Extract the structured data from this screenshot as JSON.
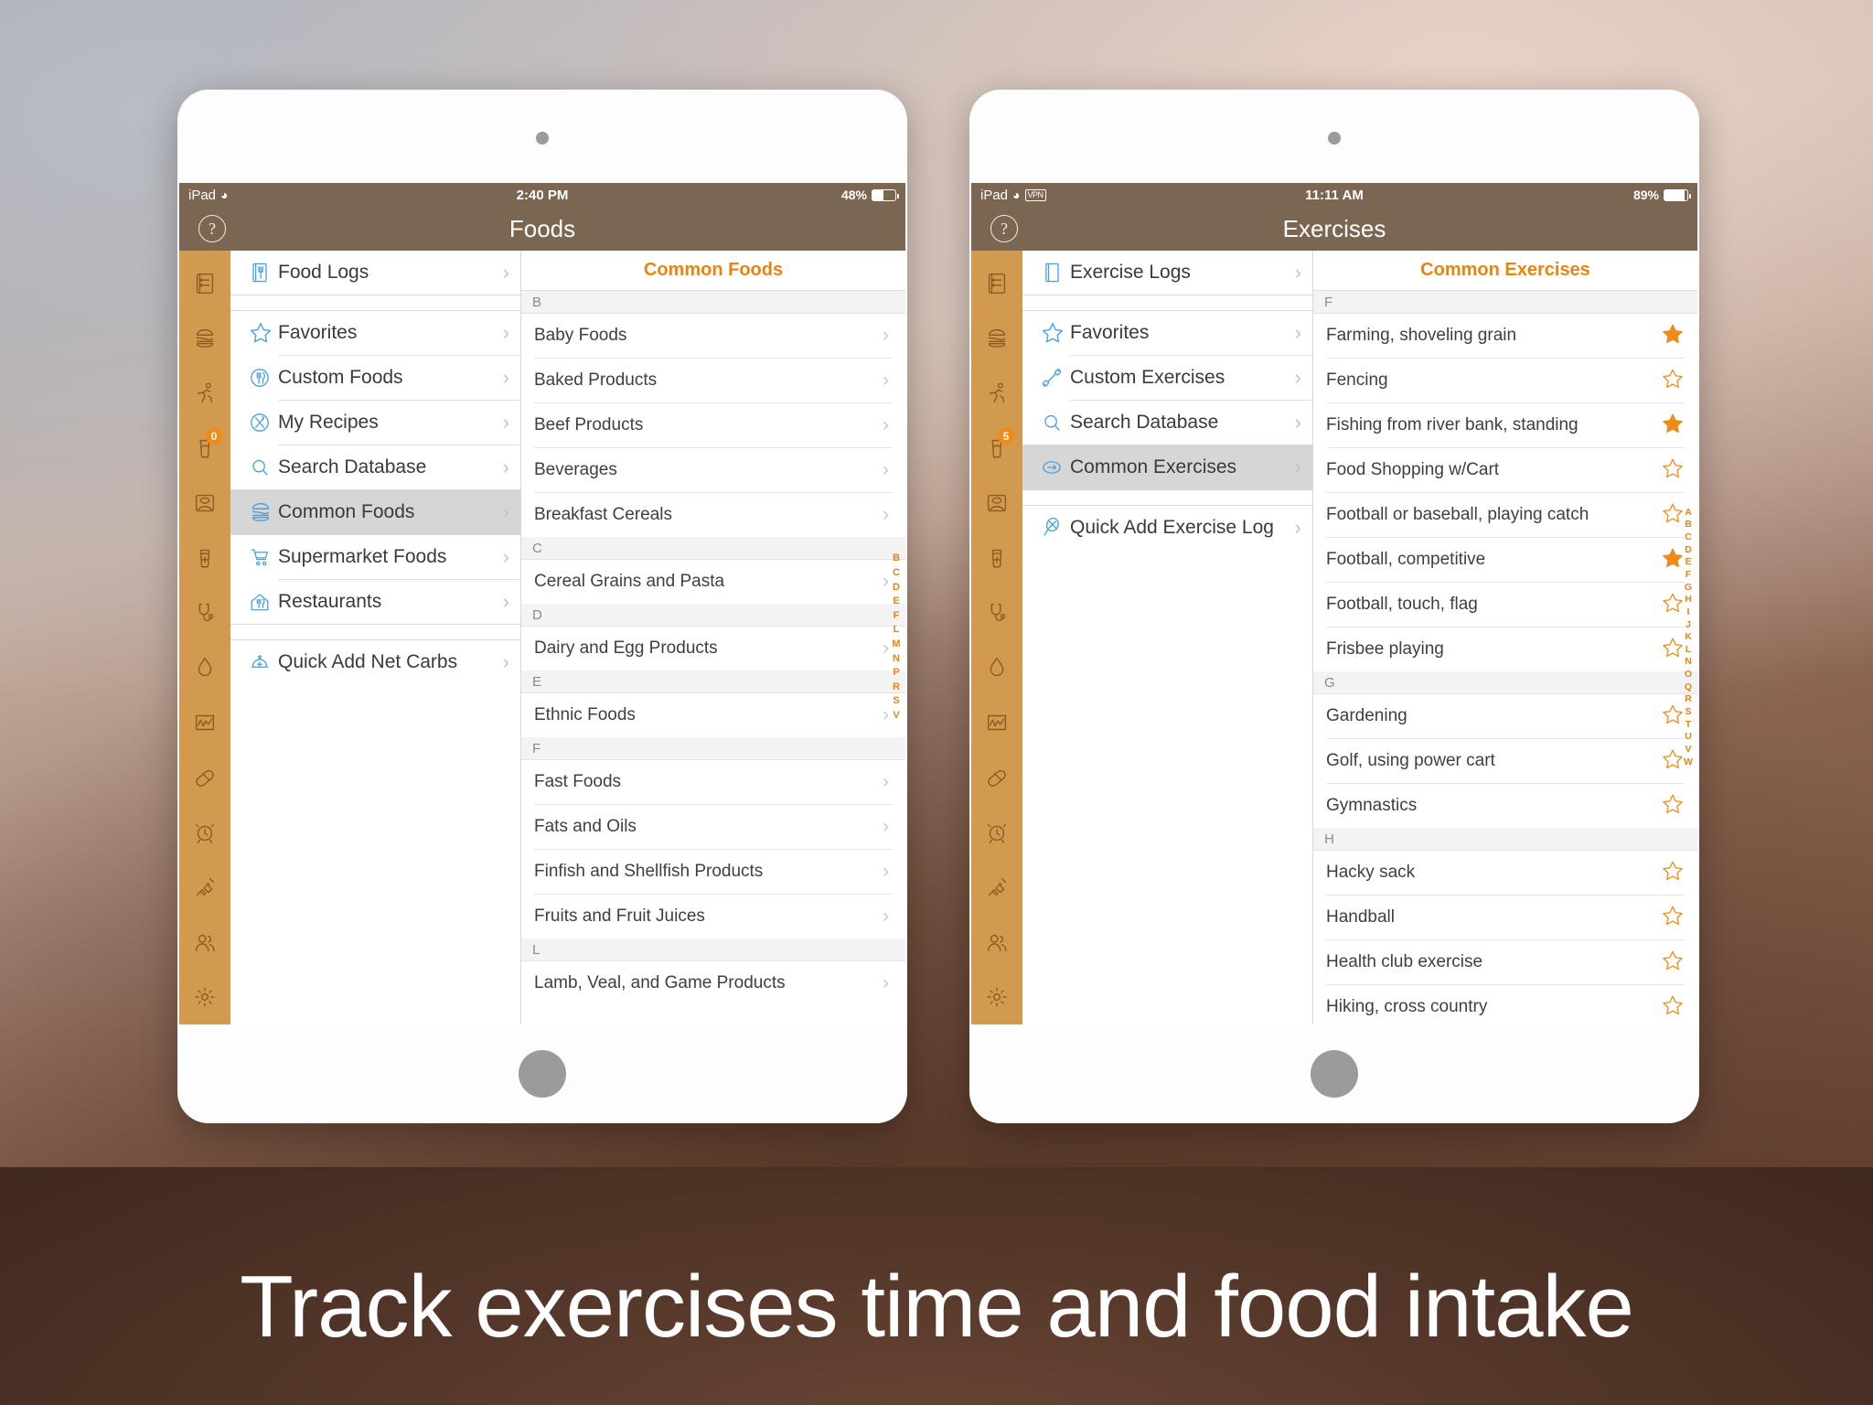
{
  "caption": "Track exercises time and food intake",
  "colors": {
    "accent": "#e98411",
    "rail": "#d29a4f",
    "navbar": "#7b6652",
    "selected_row": "#d6d6d6",
    "star_filled": "#f08a18"
  },
  "left_device": {
    "status_bar": {
      "carrier": "iPad",
      "wifi_icon": "wifi-icon",
      "time": "2:40 PM",
      "battery_percent": "48%",
      "battery_level": 48
    },
    "nav": {
      "help_label": "?",
      "title": "Foods"
    },
    "rail_items": [
      {
        "name": "logs-icon",
        "badge": null
      },
      {
        "name": "burger-icon",
        "badge": null
      },
      {
        "name": "running-icon",
        "badge": null
      },
      {
        "name": "glass-icon",
        "badge": "0"
      },
      {
        "name": "scale-icon",
        "badge": null
      },
      {
        "name": "glass-plus-icon",
        "badge": null
      },
      {
        "name": "stethoscope-icon",
        "badge": null
      },
      {
        "name": "droplet-icon",
        "badge": null
      },
      {
        "name": "chart-icon",
        "badge": null
      },
      {
        "name": "pill-icon",
        "badge": null
      },
      {
        "name": "alarm-icon",
        "badge": null
      },
      {
        "name": "syringe-icon",
        "badge": null
      },
      {
        "name": "people-icon",
        "badge": null
      },
      {
        "name": "gear-icon",
        "badge": null
      }
    ],
    "menu": [
      {
        "label": "Food Logs",
        "icon": "food-logs-icon",
        "selected": false,
        "gap_after": true
      },
      {
        "label": "Favorites",
        "icon": "star-outline-icon",
        "selected": false
      },
      {
        "label": "Custom Foods",
        "icon": "custom-foods-icon",
        "selected": false
      },
      {
        "label": "My Recipes",
        "icon": "recipes-icon",
        "selected": false
      },
      {
        "label": "Search Database",
        "icon": "search-icon",
        "selected": false
      },
      {
        "label": "Common Foods",
        "icon": "burger-icon",
        "selected": true
      },
      {
        "label": "Supermarket Foods",
        "icon": "cart-icon",
        "selected": false
      },
      {
        "label": "Restaurants",
        "icon": "restaurant-icon",
        "selected": false,
        "gap_after": true
      },
      {
        "label": "Quick Add Net Carbs",
        "icon": "quick-add-icon",
        "selected": false
      }
    ],
    "detail": {
      "header": "Common Foods",
      "sections": [
        {
          "letter": "B",
          "rows": [
            {
              "label": "Baby Foods"
            },
            {
              "label": "Baked Products"
            },
            {
              "label": "Beef Products"
            },
            {
              "label": "Beverages"
            },
            {
              "label": "Breakfast Cereals"
            }
          ]
        },
        {
          "letter": "C",
          "rows": [
            {
              "label": "Cereal Grains and Pasta"
            }
          ]
        },
        {
          "letter": "D",
          "rows": [
            {
              "label": "Dairy and Egg Products"
            }
          ]
        },
        {
          "letter": "E",
          "rows": [
            {
              "label": "Ethnic Foods"
            }
          ]
        },
        {
          "letter": "F",
          "rows": [
            {
              "label": "Fast Foods"
            },
            {
              "label": "Fats and Oils"
            },
            {
              "label": "Finfish and Shellfish Products"
            },
            {
              "label": "Fruits and Fruit Juices"
            }
          ]
        },
        {
          "letter": "L",
          "rows": [
            {
              "label": "Lamb, Veal, and Game Products"
            }
          ]
        }
      ],
      "index_letters": [
        "B",
        "C",
        "D",
        "E",
        "F",
        "L",
        "M",
        "N",
        "P",
        "R",
        "S",
        "V"
      ]
    }
  },
  "right_device": {
    "status_bar": {
      "carrier": "iPad",
      "wifi_icon": "wifi-icon",
      "vpn_label": "VPN",
      "time": "11:11 AM",
      "battery_percent": "89%",
      "battery_level": 89
    },
    "nav": {
      "help_label": "?",
      "title": "Exercises"
    },
    "rail_items": [
      {
        "name": "logs-icon",
        "badge": null
      },
      {
        "name": "burger-icon",
        "badge": null
      },
      {
        "name": "running-icon",
        "badge": null
      },
      {
        "name": "glass-icon",
        "badge": "5"
      },
      {
        "name": "scale-icon",
        "badge": null
      },
      {
        "name": "glass-plus-icon",
        "badge": null
      },
      {
        "name": "stethoscope-icon",
        "badge": null
      },
      {
        "name": "droplet-icon",
        "badge": null
      },
      {
        "name": "chart-icon",
        "badge": null
      },
      {
        "name": "pill-icon",
        "badge": null
      },
      {
        "name": "alarm-icon",
        "badge": null
      },
      {
        "name": "syringe-icon",
        "badge": null
      },
      {
        "name": "people-icon",
        "badge": null
      },
      {
        "name": "gear-icon",
        "badge": null
      }
    ],
    "menu": [
      {
        "label": "Exercise Logs",
        "icon": "exercise-logs-icon",
        "selected": false,
        "gap_after": true
      },
      {
        "label": "Favorites",
        "icon": "star-outline-icon",
        "selected": false
      },
      {
        "label": "Custom Exercises",
        "icon": "dumbbell-icon",
        "selected": false
      },
      {
        "label": "Search Database",
        "icon": "search-icon",
        "selected": false
      },
      {
        "label": "Common Exercises",
        "icon": "common-exercises-icon",
        "selected": true,
        "gap_after": true
      },
      {
        "label": "Quick Add Exercise Log",
        "icon": "racket-icon",
        "selected": false
      }
    ],
    "detail": {
      "header": "Common Exercises",
      "sections": [
        {
          "letter": "F",
          "rows": [
            {
              "label": "Farming, shoveling grain",
              "favorite": true
            },
            {
              "label": "Fencing",
              "favorite": false
            },
            {
              "label": "Fishing from river bank, standing",
              "favorite": true
            },
            {
              "label": "Food Shopping w/Cart",
              "favorite": false
            },
            {
              "label": "Football or baseball, playing catch",
              "favorite": false
            },
            {
              "label": "Football, competitive",
              "favorite": true
            },
            {
              "label": "Football, touch, flag",
              "favorite": false
            },
            {
              "label": "Frisbee playing",
              "favorite": false
            }
          ]
        },
        {
          "letter": "G",
          "rows": [
            {
              "label": "Gardening",
              "favorite": false
            },
            {
              "label": "Golf, using power cart",
              "favorite": false
            },
            {
              "label": "Gymnastics",
              "favorite": false
            }
          ]
        },
        {
          "letter": "H",
          "rows": [
            {
              "label": "Hacky sack",
              "favorite": false
            },
            {
              "label": "Handball",
              "favorite": false
            },
            {
              "label": "Health club exercise",
              "favorite": false
            },
            {
              "label": "Hiking, cross country",
              "favorite": false
            }
          ]
        }
      ],
      "index_letters": [
        "A",
        "B",
        "C",
        "D",
        "E",
        "F",
        "G",
        "H",
        "I",
        "J",
        "K",
        "L",
        "N",
        "O",
        "Q",
        "R",
        "S",
        "T",
        "U",
        "V",
        "W"
      ]
    }
  }
}
